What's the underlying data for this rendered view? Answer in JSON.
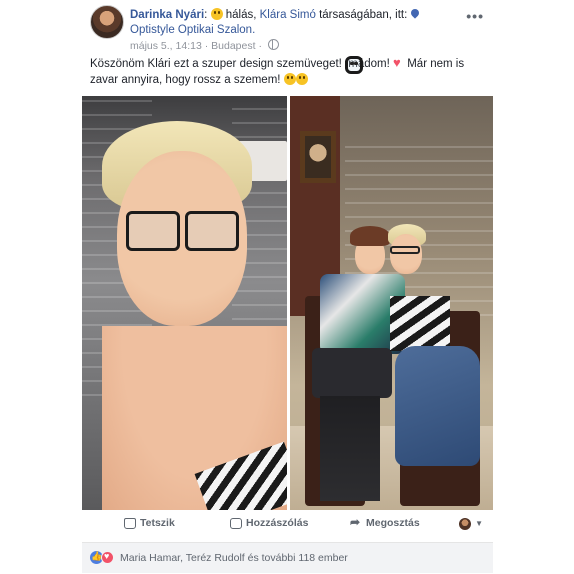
{
  "post": {
    "author": "Darinka Nyári",
    "feeling": "hálás,",
    "with_name": "Klára Simó",
    "with_suffix": "társaságában, itt:",
    "place": "Optistyle Optikai Szalon.",
    "date": "május 5., 14:13",
    "location": "Budapest",
    "dot": "·",
    "more": "•••",
    "text_part1": "Köszönöm Klári ezt a szuper design szemüveget!",
    "text_part2": "Imádom!",
    "text_part3": "Már nem is zavar annyira, hogy rossz a szemem!",
    "emojis": [
      "smiling-face-icon",
      "sunglasses-face-icon",
      "sparkling-heart-icon",
      "smiling-face-icon",
      "kissing-face-icon"
    ]
  },
  "actions": {
    "like": "Tetszik",
    "comment": "Hozzászólás",
    "share": "Megosztás"
  },
  "reactions": {
    "summary": "Maria Hamar, Teréz Rudolf és további 118 ember",
    "colors": {
      "like": "#4d7ee0",
      "love": "#f25268"
    }
  },
  "colors": {
    "link": "#365899",
    "meta": "#90949c",
    "reactions_bg": "#f2f3f5"
  }
}
